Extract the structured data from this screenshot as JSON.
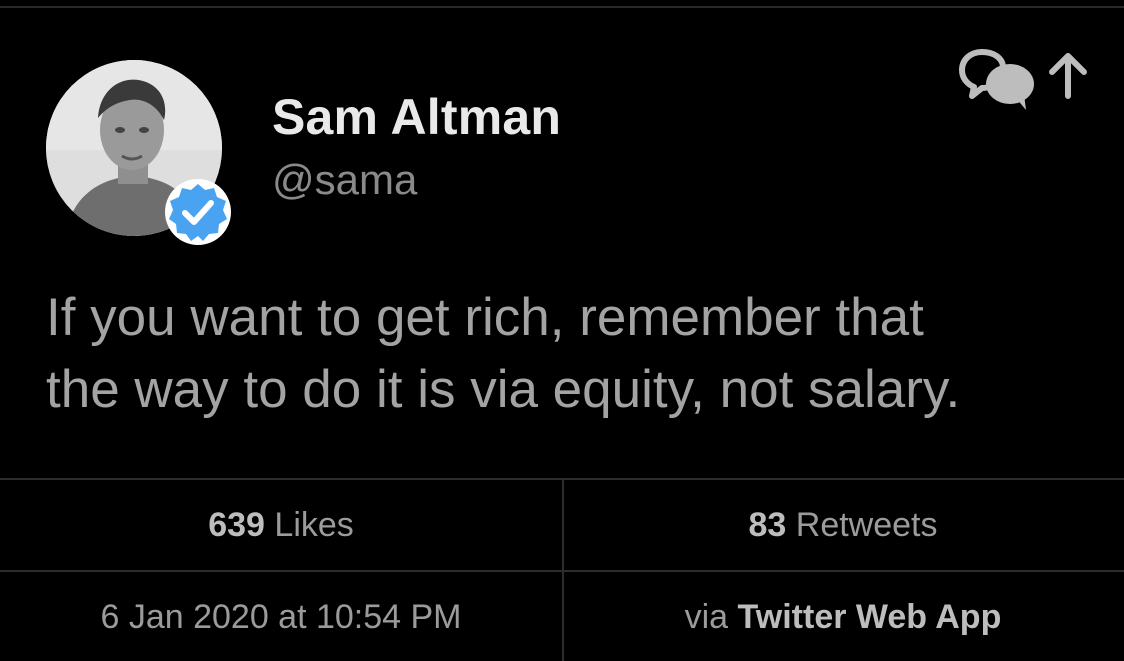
{
  "tweet": {
    "author_name": "Sam Altman",
    "author_handle": "@sama",
    "verified": true,
    "text_lines": [
      "If you want to get rich, remember that",
      "the way to do it is via equity, not salary."
    ]
  },
  "stats": {
    "likes_count": "639",
    "likes_label": "Likes",
    "retweets_count": "83",
    "retweets_label": "Retweets"
  },
  "meta": {
    "timestamp": "6 Jan 2020 at 10:54 PM",
    "via_prefix": "via",
    "source_app": "Twitter Web App"
  },
  "icons": {
    "reply": "reply-bubbles-icon",
    "share": "share-arrow-icon",
    "verified": "verified-badge-icon"
  },
  "colors": {
    "background": "#000000",
    "verified_blue": "#4aa3f0",
    "name_text": "#e9e9e9",
    "secondary_text": "#8a8a8a"
  }
}
